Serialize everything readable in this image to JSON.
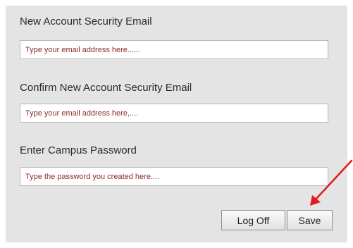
{
  "form": {
    "new_email": {
      "label": "New Account Security Email",
      "placeholder": "Type your email address here......"
    },
    "confirm_email": {
      "label": "Confirm New Account Security Email",
      "placeholder": "Type your email address here,...."
    },
    "password": {
      "label": "Enter Campus Password",
      "placeholder": "Type the password you created here...."
    }
  },
  "buttons": {
    "logoff_label": "Log Off",
    "save_label": "Save"
  },
  "annotation": {
    "arrow_icon": "red-arrow-icon",
    "arrow_color": "#e21b1b"
  },
  "colors": {
    "panel_background": "#e4e4e4",
    "placeholder_text": "#8e2a2a"
  }
}
